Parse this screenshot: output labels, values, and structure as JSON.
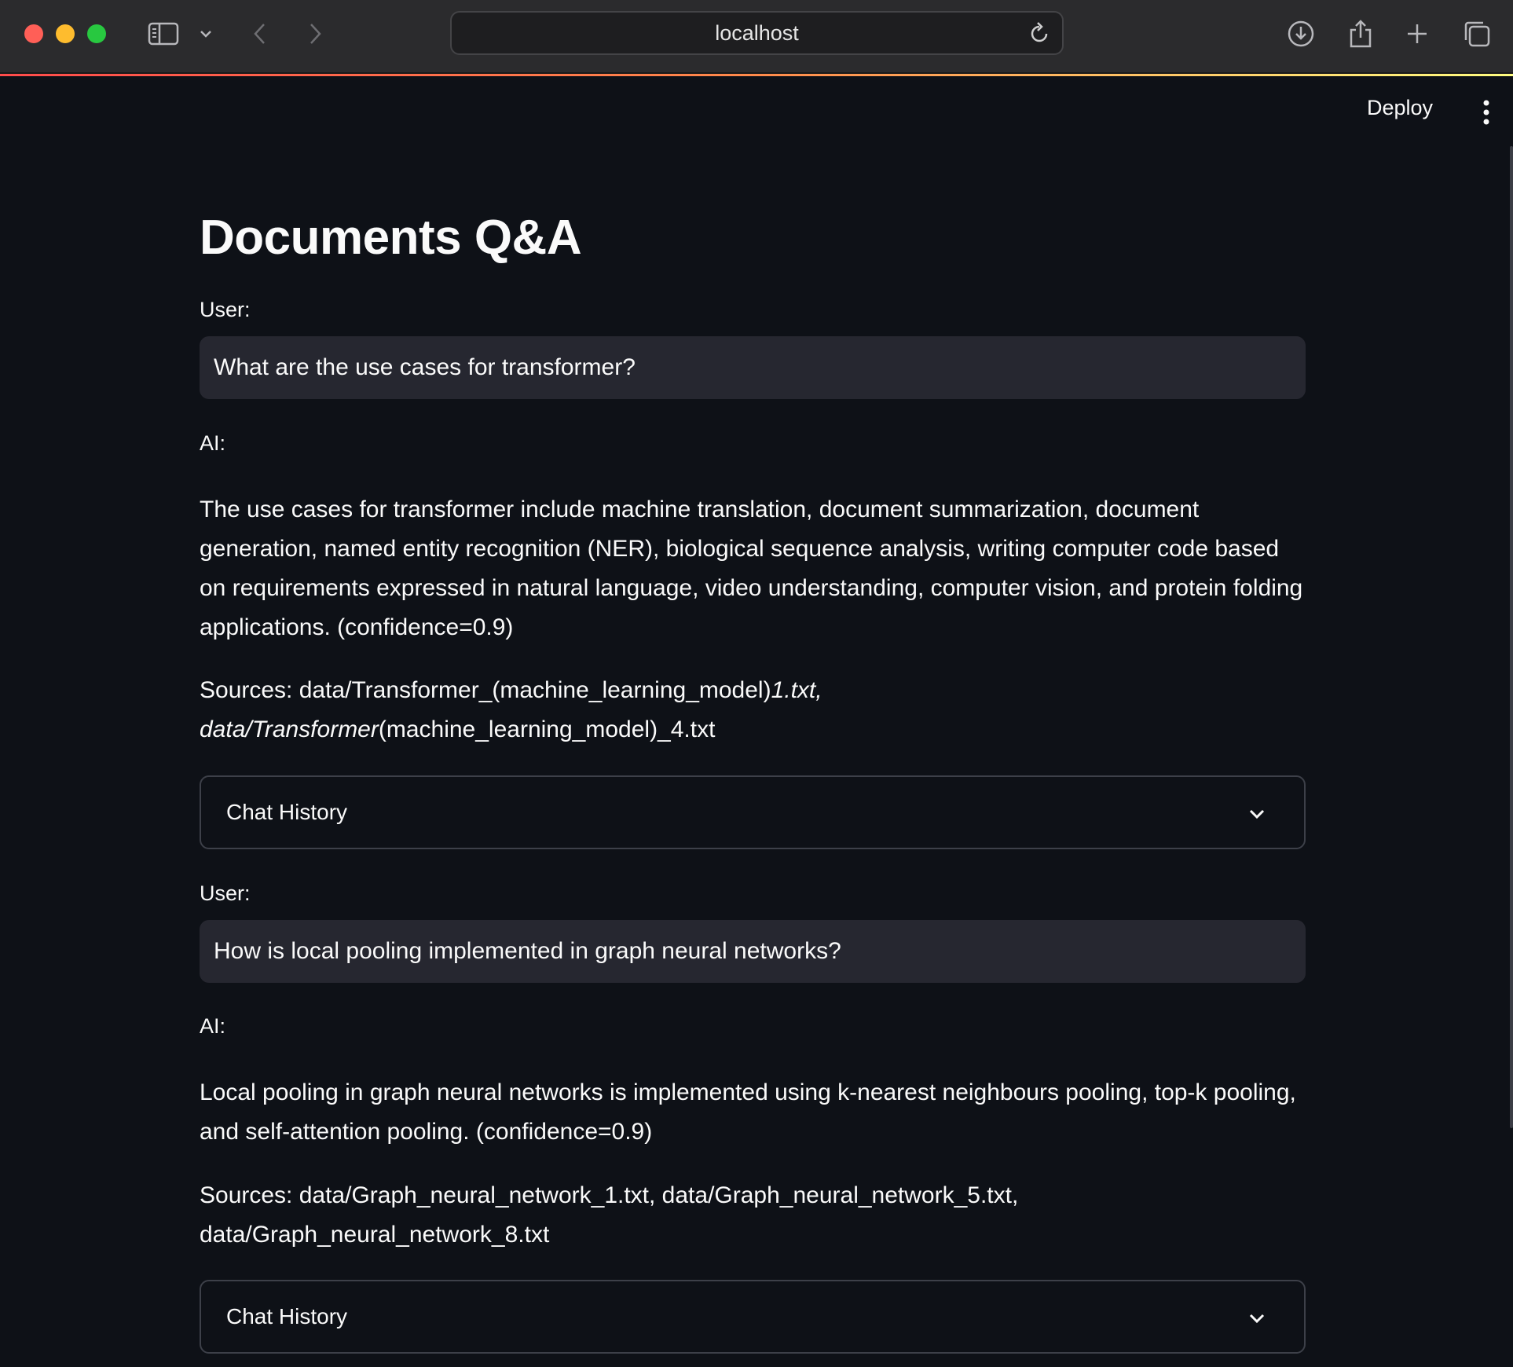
{
  "browser": {
    "url": "localhost"
  },
  "app": {
    "deploy_label": "Deploy"
  },
  "page": {
    "title": "Documents Q&A"
  },
  "conversation": [
    {
      "user_label": "User:",
      "question": "What are the use cases for transformer?",
      "ai_label": "AI:",
      "answer": "The use cases for transformer include machine translation, document summarization, document generation, named entity recognition (NER), biological sequence analysis, writing computer code based on requirements expressed in natural language, video understanding, computer vision, and protein folding applications. (confidence=0.9)",
      "sources_line1_a": "Sources: data/Transformer_(machine_learning_model)",
      "sources_line1_b": "1.txt,",
      "sources_line2_a": "data/Transformer",
      "sources_line2_b": "(machine_learning_model)_4.txt",
      "history_label": "Chat History"
    },
    {
      "user_label": "User:",
      "question": "How is local pooling implemented in graph neural networks?",
      "ai_label": "AI:",
      "answer": "Local pooling in graph neural networks is implemented using k-nearest neighbours pooling, top-k pooling, and self-attention pooling. (confidence=0.9)",
      "sources_line1": "Sources: data/Graph_neural_network_1.txt, data/Graph_neural_network_5.txt,",
      "sources_line2": "data/Graph_neural_network_8.txt",
      "history_label": "Chat History"
    }
  ],
  "colors": {
    "background": "#0e1117",
    "input_bg": "#262730",
    "border": "#3d4049",
    "text": "#fafafa"
  }
}
